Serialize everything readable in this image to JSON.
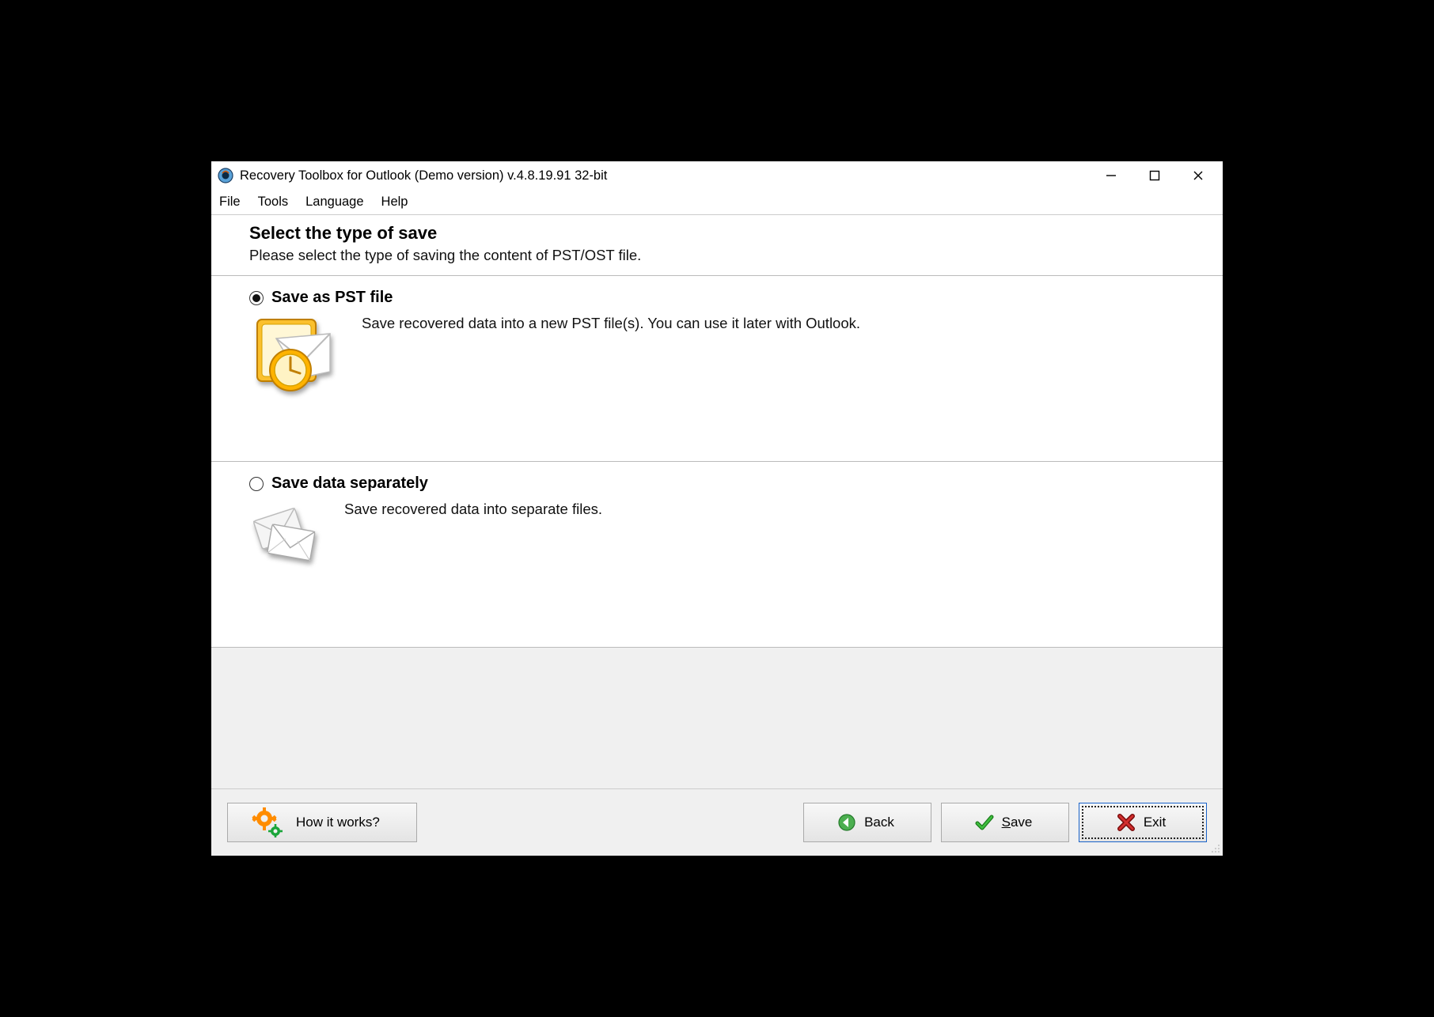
{
  "title": "Recovery Toolbox for Outlook (Demo version) v.4.8.19.91 32-bit",
  "menu": {
    "file": "File",
    "tools": "Tools",
    "language": "Language",
    "help": "Help"
  },
  "header": {
    "title": "Select the type of save",
    "subtitle": "Please select the type of saving the content of PST/OST file."
  },
  "options": [
    {
      "label": "Save as PST file",
      "description": "Save recovered data into a new PST file(s). You can use it later with Outlook.",
      "selected": true
    },
    {
      "label": "Save data separately",
      "description": "Save recovered data into separate files.",
      "selected": false
    }
  ],
  "footer": {
    "how_it_works": "How it works?",
    "back": "Back",
    "save": "Save",
    "exit": "Exit"
  }
}
